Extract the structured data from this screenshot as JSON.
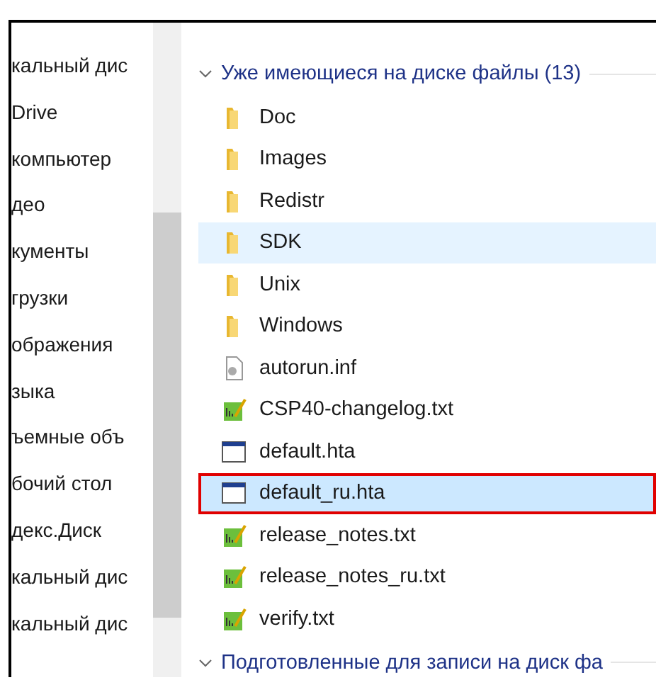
{
  "sidebar": {
    "items": [
      {
        "label": "кальный дис"
      },
      {
        "label": "Drive"
      },
      {
        "label": "компьютер"
      },
      {
        "label": "део"
      },
      {
        "label": "кументы"
      },
      {
        "label": "грузки"
      },
      {
        "label": "ображения"
      },
      {
        "label": "зыка"
      },
      {
        "label": "ъемные объ"
      },
      {
        "label": "бочий стол"
      },
      {
        "label": "декс.Диск"
      },
      {
        "label": "кальный дис"
      },
      {
        "label": "кальный дис"
      }
    ]
  },
  "groups": [
    {
      "title": "Уже имеющиеся на диске файлы (13)",
      "expanded": true,
      "files": [
        {
          "name": "Doc",
          "kind": "folder",
          "highlighted": false,
          "selected": false,
          "outlined": false
        },
        {
          "name": "Images",
          "kind": "folder",
          "highlighted": false,
          "selected": false,
          "outlined": false
        },
        {
          "name": "Redistr",
          "kind": "folder",
          "highlighted": false,
          "selected": false,
          "outlined": false
        },
        {
          "name": "SDK",
          "kind": "folder",
          "highlighted": true,
          "selected": false,
          "outlined": false
        },
        {
          "name": "Unix",
          "kind": "folder",
          "highlighted": false,
          "selected": false,
          "outlined": false
        },
        {
          "name": "Windows",
          "kind": "folder",
          "highlighted": false,
          "selected": false,
          "outlined": false
        },
        {
          "name": "autorun.inf",
          "kind": "settings",
          "highlighted": false,
          "selected": false,
          "outlined": false
        },
        {
          "name": "CSP40-changelog.txt",
          "kind": "text",
          "highlighted": false,
          "selected": false,
          "outlined": false
        },
        {
          "name": "default.hta",
          "kind": "app",
          "highlighted": false,
          "selected": false,
          "outlined": false
        },
        {
          "name": "default_ru.hta",
          "kind": "app",
          "highlighted": false,
          "selected": true,
          "outlined": true
        },
        {
          "name": "release_notes.txt",
          "kind": "text",
          "highlighted": false,
          "selected": false,
          "outlined": false
        },
        {
          "name": "release_notes_ru.txt",
          "kind": "text",
          "highlighted": false,
          "selected": false,
          "outlined": false
        },
        {
          "name": "verify.txt",
          "kind": "text",
          "highlighted": false,
          "selected": false,
          "outlined": false
        }
      ]
    },
    {
      "title": "Подготовленные для записи на диск фа",
      "expanded": true
    }
  ]
}
